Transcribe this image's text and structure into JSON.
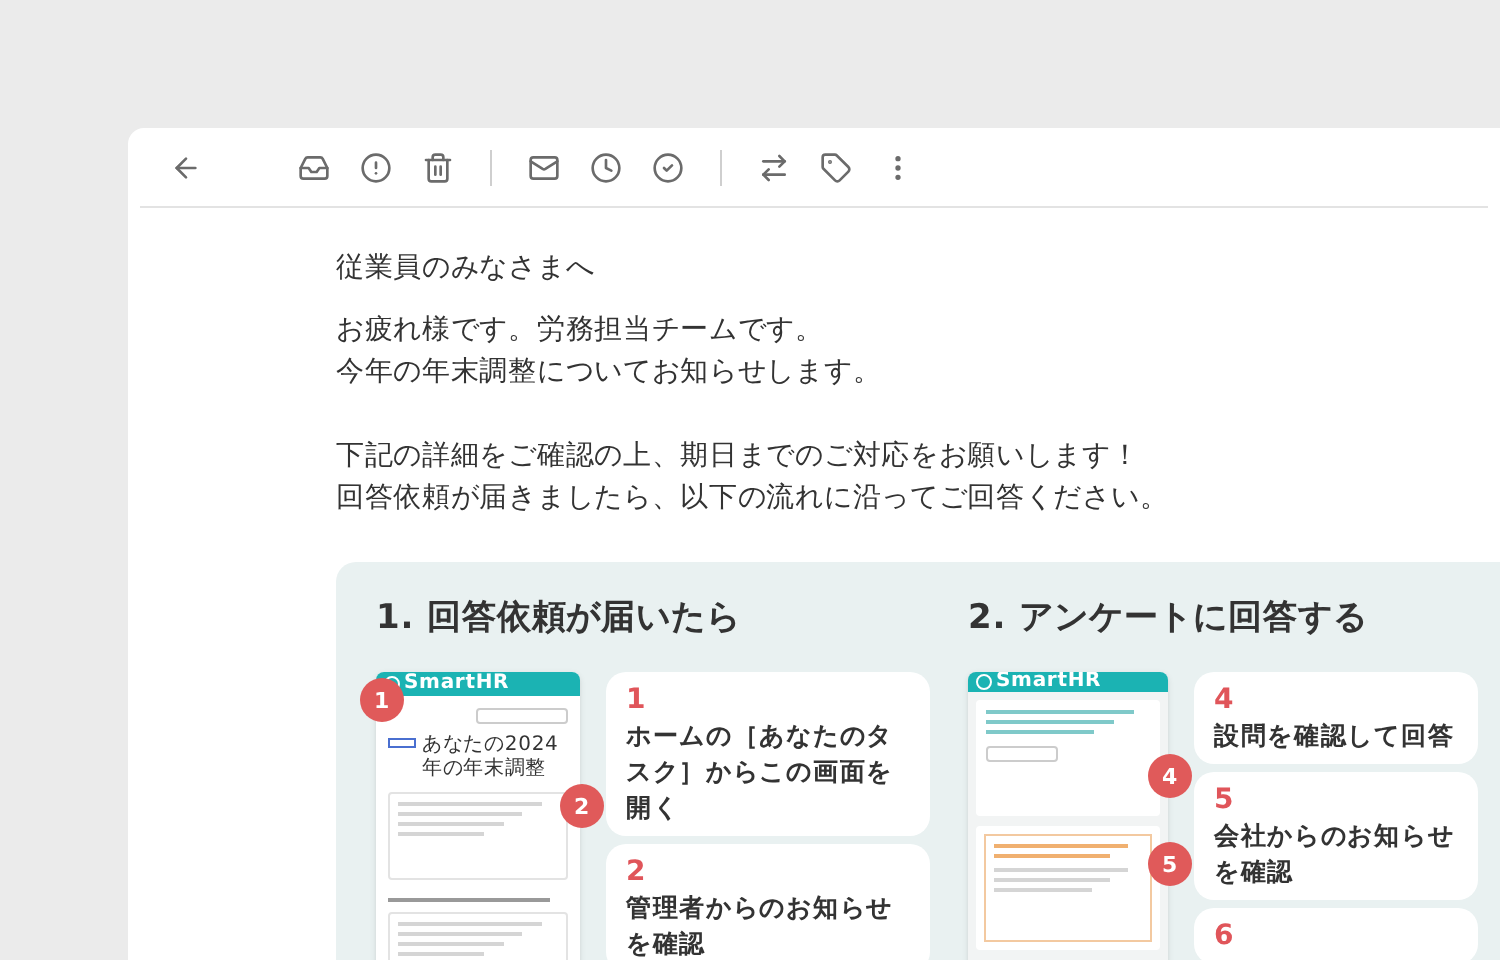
{
  "email": {
    "greeting": "従業員のみなさまへ",
    "paragraphs": [
      [
        "お疲れ様です。労務担当チームです。",
        "今年の年末調整についてお知らせします。"
      ],
      [
        "下記の詳細をご確認の上、期日までのご対応をお願いします！",
        "回答依頼が届きましたら、以下の流れに沿ってご回答ください。"
      ]
    ]
  },
  "guide": {
    "sections": [
      {
        "heading": "1. 回答依頼が届いたら",
        "mockup": {
          "kind": "task",
          "logo": "SmartHR",
          "title": "あなたの2024年の年末調整"
        },
        "badges": [
          "1",
          "2"
        ],
        "steps": [
          {
            "number": "1",
            "text": "ホームの［あなたのタスク］からこの画面を開く"
          },
          {
            "number": "2",
            "text": "管理者からのお知らせを確認"
          }
        ]
      },
      {
        "heading": "2. アンケートに回答する",
        "mockup": {
          "kind": "survey",
          "logo": "SmartHR"
        },
        "badges": [
          "4",
          "5"
        ],
        "steps": [
          {
            "number": "4",
            "text": "設問を確認して回答"
          },
          {
            "number": "5",
            "text": "会社からのお知らせを確認"
          },
          {
            "number": "6"
          }
        ]
      }
    ]
  }
}
